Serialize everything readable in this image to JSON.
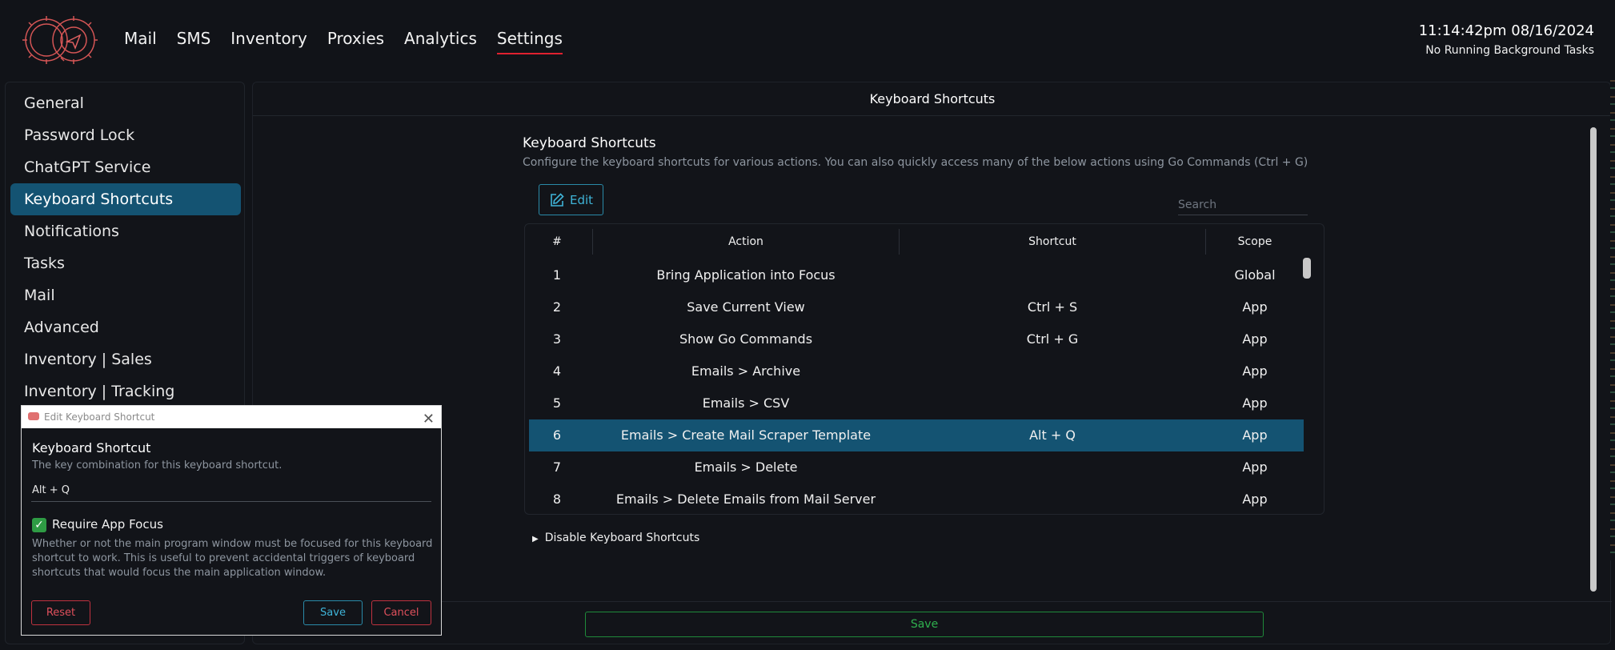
{
  "nav": {
    "items": [
      "Mail",
      "SMS",
      "Inventory",
      "Proxies",
      "Analytics",
      "Settings"
    ],
    "active": "Settings"
  },
  "status": {
    "time": "11:14:42pm 08/16/2024",
    "tasks": "No Running Background Tasks"
  },
  "sidebar": {
    "items": [
      {
        "label": "General"
      },
      {
        "label": "Password Lock"
      },
      {
        "label": "ChatGPT Service"
      },
      {
        "label": "Keyboard Shortcuts"
      },
      {
        "label": "Notifications"
      },
      {
        "label": "Tasks"
      },
      {
        "label": "Mail"
      },
      {
        "label": "Advanced"
      },
      {
        "label": "Inventory | Sales"
      },
      {
        "label": "Inventory | Tracking"
      }
    ],
    "active": "Keyboard Shortcuts"
  },
  "main": {
    "title": "Keyboard Shortcuts",
    "section_title": "Keyboard Shortcuts",
    "section_desc": "Configure the keyboard shortcuts for various actions. You can also quickly access many of the below actions using Go Commands (Ctrl + G)",
    "edit_label": "Edit",
    "search_placeholder": "Search",
    "columns": {
      "num": "#",
      "action": "Action",
      "shortcut": "Shortcut",
      "scope": "Scope"
    },
    "rows": [
      {
        "num": "1",
        "action": "Bring Application into Focus",
        "shortcut": "",
        "scope": "Global"
      },
      {
        "num": "2",
        "action": "Save Current View",
        "shortcut": "Ctrl + S",
        "scope": "App"
      },
      {
        "num": "3",
        "action": "Show Go Commands",
        "shortcut": "Ctrl + G",
        "scope": "App"
      },
      {
        "num": "4",
        "action": "Emails > Archive",
        "shortcut": "",
        "scope": "App"
      },
      {
        "num": "5",
        "action": "Emails > CSV",
        "shortcut": "",
        "scope": "App"
      },
      {
        "num": "6",
        "action": "Emails > Create Mail Scraper Template",
        "shortcut": "Alt + Q",
        "scope": "App"
      },
      {
        "num": "7",
        "action": "Emails > Delete",
        "shortcut": "",
        "scope": "App"
      },
      {
        "num": "8",
        "action": "Emails > Delete Emails from Mail Server",
        "shortcut": "",
        "scope": "App"
      }
    ],
    "selected_row": "6",
    "disable_label": "Disable Keyboard Shortcuts",
    "save_label": "Save"
  },
  "dialog": {
    "title": "Edit Keyboard Shortcut",
    "field_label": "Keyboard Shortcut",
    "field_desc": "The key combination for this keyboard shortcut.",
    "field_value": "Alt + Q",
    "checkbox_label": "Require App Focus",
    "checkbox_checked": true,
    "checkbox_desc": "Whether or not the main program window must be focused for this keyboard shortcut to work. This is useful to prevent accidental triggers of keyboard shortcuts that would focus the main application window.",
    "reset_label": "Reset",
    "save_label": "Save",
    "cancel_label": "Cancel"
  },
  "colors": {
    "accent": "#145372",
    "danger": "#e0212f",
    "success": "#2fb04e",
    "background": "#111318"
  }
}
